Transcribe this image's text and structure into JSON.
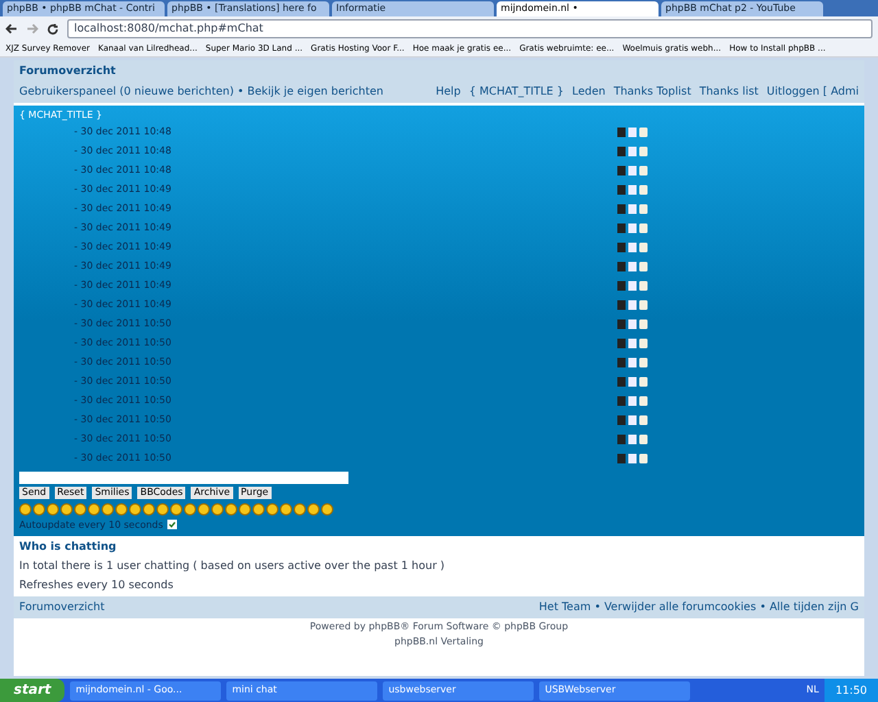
{
  "tabs": [
    {
      "label": "phpBB • phpBB mChat - Contri",
      "selected": false
    },
    {
      "label": "phpBB • [Translations] here fo",
      "selected": false
    },
    {
      "label": "Informatie",
      "selected": false
    },
    {
      "label": "mijndomein.nl •",
      "selected": true
    },
    {
      "label": "phpBB mChat p2 - YouTube",
      "selected": false
    }
  ],
  "address": "localhost:8080/mchat.php#mChat",
  "bookmarks": [
    "XJZ Survey Remover",
    "Kanaal van Lilredhead...",
    "Super Mario 3D Land ...",
    "Gratis Hosting Voor F...",
    "Hoe maak je gratis ee...",
    "Gratis webruimte: ee...",
    "Woelmuis gratis webh...",
    "How to Install phpBB ..."
  ],
  "breadcrumb": "Forumoverzicht",
  "nav_left": "Gebruikerspaneel (0 nieuwe berichten) • Bekijk je eigen berichten",
  "nav_right": [
    "Help",
    "{ MCHAT_TITLE }",
    "Leden",
    "Thanks Toplist",
    "Thanks list",
    "Uitloggen [ Admi"
  ],
  "chat": {
    "title": "{ MCHAT_TITLE }",
    "messages": [
      {
        "time": "- 30 dec 2011 10:48"
      },
      {
        "time": "- 30 dec 2011 10:48"
      },
      {
        "time": "- 30 dec 2011 10:48"
      },
      {
        "time": "- 30 dec 2011 10:49"
      },
      {
        "time": "- 30 dec 2011 10:49"
      },
      {
        "time": "- 30 dec 2011 10:49"
      },
      {
        "time": "- 30 dec 2011 10:49"
      },
      {
        "time": "- 30 dec 2011 10:49"
      },
      {
        "time": "- 30 dec 2011 10:49"
      },
      {
        "time": "- 30 dec 2011 10:49"
      },
      {
        "time": "- 30 dec 2011 10:50"
      },
      {
        "time": "- 30 dec 2011 10:50"
      },
      {
        "time": "- 30 dec 2011 10:50"
      },
      {
        "time": "- 30 dec 2011 10:50"
      },
      {
        "time": "- 30 dec 2011 10:50"
      },
      {
        "time": "- 30 dec 2011 10:50"
      },
      {
        "time": "- 30 dec 2011 10:50"
      },
      {
        "time": "- 30 dec 2011 10:50"
      }
    ],
    "buttons": [
      "Send",
      "Reset",
      "Smilies",
      "BBCodes",
      "Archive",
      "Purge"
    ],
    "autoupdate": {
      "label": "Autoupdate every 10 seconds",
      "checked": true
    }
  },
  "who": {
    "title": "Who is chatting",
    "total": "In total there is 1 user chatting ( based on users active over the past 1 hour )",
    "refresh": "Refreshes every 10 seconds"
  },
  "footer": {
    "left": "Forumoverzicht",
    "right": "Het Team • Verwijder alle forumcookies • Alle tijden zijn G"
  },
  "powered": [
    "Powered by phpBB® Forum Software © phpBB Group",
    "phpBB.nl Vertaling"
  ],
  "taskbar": {
    "start": "start",
    "items": [
      "mijndomein.nl - Goo...",
      "mini chat",
      "usbwebserver",
      "USBWebserver"
    ],
    "lang": "NL",
    "clock": "11:50"
  }
}
